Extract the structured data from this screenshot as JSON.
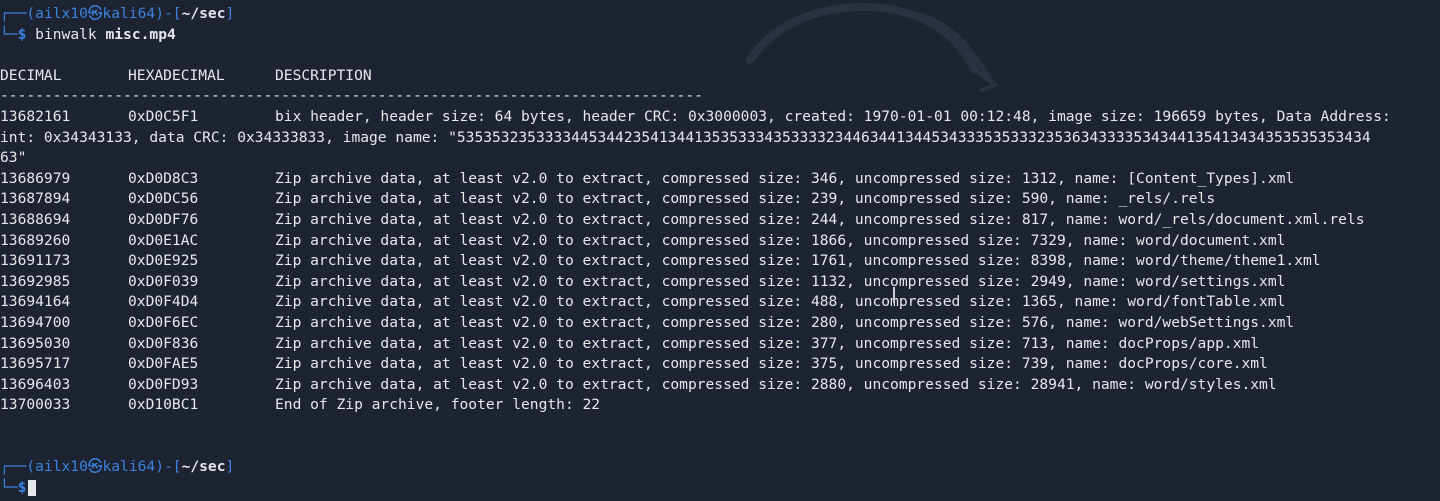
{
  "prompt": {
    "frame_top": "┌──(",
    "user": "ailx10",
    "at": "㉿",
    "host": "kali64",
    "mid": ")-[",
    "path": "~/sec",
    "end": "]",
    "frame_bottom": "└─",
    "dollar": "$"
  },
  "command": {
    "program": "binwalk",
    "argument": "misc.mp4"
  },
  "table": {
    "headers": [
      "DECIMAL",
      "HEXADECIMAL",
      "DESCRIPTION"
    ],
    "separator": "--------------------------------------------------------------------------------",
    "rows": [
      {
        "decimal": "13682161",
        "hex": "0xD0C5F1",
        "description": "bix header, header size: 64 bytes, header CRC: 0x3000003, created: 1970-01-01 00:12:48, image size: 196659 bytes, Data Address:"
      },
      {
        "decimal": "",
        "hex": "",
        "description": "int: 0x34343133, data CRC: 0x34333833, image name: \"53535323533334453442354134413535333435333323446344134453433353533323536343333534344135413434353535353434"
      },
      {
        "decimal": "",
        "hex": "",
        "description": "63\""
      },
      {
        "decimal": "13686979",
        "hex": "0xD0D8C3",
        "description": "Zip archive data, at least v2.0 to extract, compressed size: 346, uncompressed size: 1312, name: [Content_Types].xml"
      },
      {
        "decimal": "13687894",
        "hex": "0xD0DC56",
        "description": "Zip archive data, at least v2.0 to extract, compressed size: 239, uncompressed size: 590, name: _rels/.rels"
      },
      {
        "decimal": "13688694",
        "hex": "0xD0DF76",
        "description": "Zip archive data, at least v2.0 to extract, compressed size: 244, uncompressed size: 817, name: word/_rels/document.xml.rels"
      },
      {
        "decimal": "13689260",
        "hex": "0xD0E1AC",
        "description": "Zip archive data, at least v2.0 to extract, compressed size: 1866, uncompressed size: 7329, name: word/document.xml"
      },
      {
        "decimal": "13691173",
        "hex": "0xD0E925",
        "description": "Zip archive data, at least v2.0 to extract, compressed size: 1761, uncompressed size: 8398, name: word/theme/theme1.xml"
      },
      {
        "decimal": "13692985",
        "hex": "0xD0F039",
        "description": "Zip archive data, at least v2.0 to extract, compressed size: 1132, uncompressed size: 2949, name: word/settings.xml"
      },
      {
        "decimal": "13694164",
        "hex": "0xD0F4D4",
        "description": "Zip archive data, at least v2.0 to extract, compressed size: 488, uncompressed size: 1365, name: word/fontTable.xml"
      },
      {
        "decimal": "13694700",
        "hex": "0xD0F6EC",
        "description": "Zip archive data, at least v2.0 to extract, compressed size: 280, uncompressed size: 576, name: word/webSettings.xml"
      },
      {
        "decimal": "13695030",
        "hex": "0xD0F836",
        "description": "Zip archive data, at least v2.0 to extract, compressed size: 377, uncompressed size: 713, name: docProps/app.xml"
      },
      {
        "decimal": "13695717",
        "hex": "0xD0FAE5",
        "description": "Zip archive data, at least v2.0 to extract, compressed size: 375, uncompressed size: 739, name: docProps/core.xml"
      },
      {
        "decimal": "13696403",
        "hex": "0xD0FD93",
        "description": "Zip archive data, at least v2.0 to extract, compressed size: 2880, uncompressed size: 28941, name: word/styles.xml"
      },
      {
        "decimal": "13700033",
        "hex": "0xD10BC1",
        "description": "End of Zip archive, footer length: 22"
      }
    ]
  },
  "colors": {
    "background": "#1d2330",
    "prompt_accent": "#3a84e0",
    "text": "#e6e8ec"
  },
  "icons": {
    "watermark": "kali-dragon-icon",
    "text_cursor": "ibeam-cursor-icon",
    "terminal_cursor": "block-cursor-icon"
  }
}
